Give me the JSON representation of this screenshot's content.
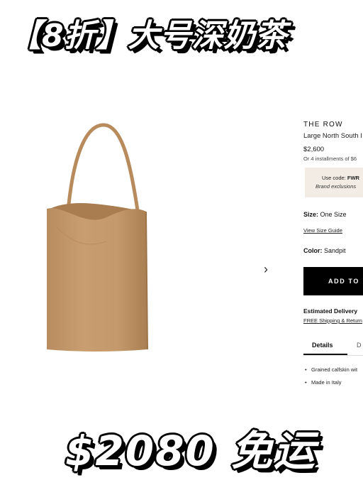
{
  "banner": {
    "top_text": "【8折】大号深奶茶",
    "bottom_text": "$2080 免运"
  },
  "product": {
    "brand": "THE ROW",
    "name": "Large North South I",
    "price": "$2,600",
    "installments": "Or 4 installments of $6",
    "promo_prefix": "Use code:",
    "promo_code": "FWR",
    "promo_note": "Brand exclusions",
    "size_label": "Size:",
    "size_value": "One Size",
    "size_guide": "View Size Guide",
    "color_label": "Color:",
    "color_value": "Sandpit",
    "add_button": "ADD TO",
    "estimated_delivery": "Estimated Delivery",
    "shipping_link": "FREE Shipping & Return",
    "tabs": [
      "Details",
      "D"
    ],
    "bullets": [
      "Grained calfskin wit",
      "Made in Italy"
    ]
  },
  "gallery": {
    "next_icon": "chevron-right-icon",
    "next_glyph": "›"
  },
  "colors": {
    "bag": "#c49a6c",
    "promo_bg": "#f3ece4",
    "button_bg": "#000000"
  }
}
